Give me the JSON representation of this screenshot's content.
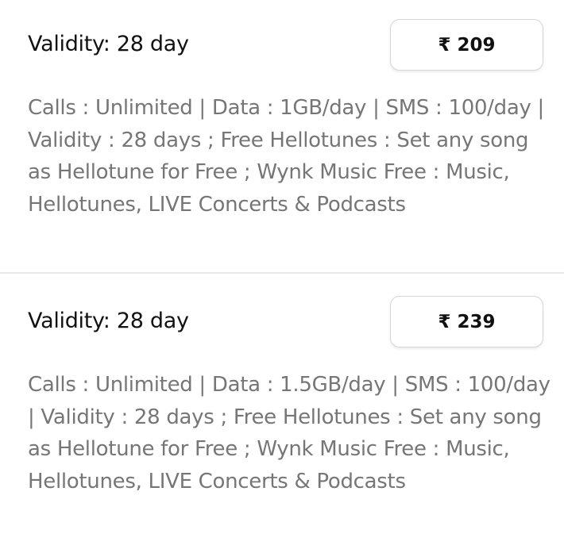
{
  "plans": [
    {
      "validity": "Validity:  28 day",
      "price": "₹ 209",
      "description": "Calls : Unlimited | Data : 1GB/day | SMS : 100/day | Validity : 28 days ; Free Hellotunes : Set any song as Hellotune for Free ; Wynk Music Free : Music, Hellotunes, LIVE Concerts & Podcasts"
    },
    {
      "validity": "Validity:  28 day",
      "price": "₹ 239",
      "description": "Calls : Unlimited | Data : 1.5GB/day | SMS : 100/day | Validity : 28 days ; Free Hellotunes : Set any song as Hellotune for Free ; Wynk Music Free : Music, Hellotunes, LIVE Concerts & Podcasts"
    }
  ]
}
